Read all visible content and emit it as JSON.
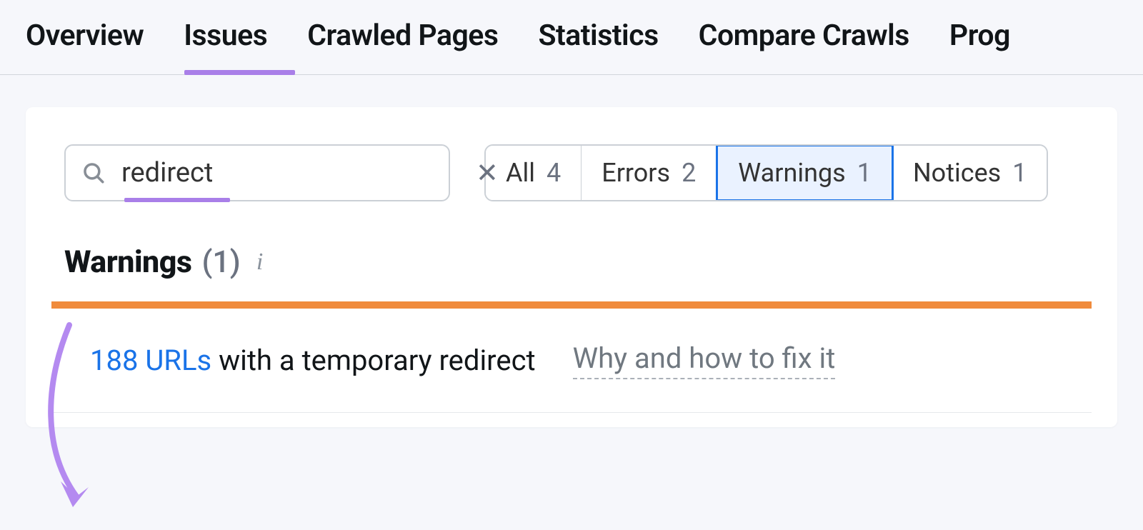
{
  "nav": {
    "tabs": [
      {
        "label": "Overview"
      },
      {
        "label": "Issues"
      },
      {
        "label": "Crawled Pages"
      },
      {
        "label": "Statistics"
      },
      {
        "label": "Compare Crawls"
      },
      {
        "label": "Prog"
      }
    ],
    "activeIndex": 1
  },
  "search": {
    "value": "redirect"
  },
  "filters": [
    {
      "label": "All",
      "count": "4"
    },
    {
      "label": "Errors",
      "count": "2"
    },
    {
      "label": "Warnings",
      "count": "1"
    },
    {
      "label": "Notices",
      "count": "1"
    }
  ],
  "filtersActiveIndex": 2,
  "section": {
    "title": "Warnings",
    "count": "(1)"
  },
  "issue": {
    "count_label": "188 URLs",
    "description": " with a temporary redirect",
    "fix_label": "Why and how to fix it"
  }
}
